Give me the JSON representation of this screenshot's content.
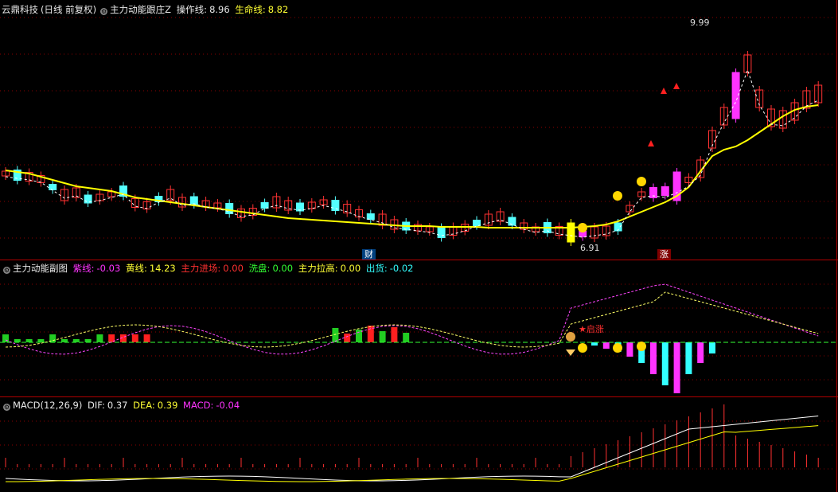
{
  "main_panel": {
    "stock": "云鼎科技",
    "period": "(日线 前复权)",
    "indicator": "主力动能跟庄Z",
    "op_line_label": "操作线:",
    "op_line_value": "8.96",
    "life_line_label": "生命线:",
    "life_line_value": "8.82",
    "high_label": "9.99",
    "low_label": "6.91",
    "marker_cai": "财",
    "marker_zhang": "涨"
  },
  "sub_panel": {
    "indicator": "主力动能副图",
    "purple_label": "紫线:",
    "purple_value": "-0.03",
    "yellow_label": "黄线:",
    "yellow_value": "14.23",
    "enter_label": "主力进场:",
    "enter_value": "0.00",
    "wash_label": "洗盘:",
    "wash_value": "0.00",
    "pull_label": "主力拉高:",
    "pull_value": "0.00",
    "ship_label": "出货:",
    "ship_value": "-0.02",
    "star_text": "★启涨"
  },
  "macd_panel": {
    "indicator": "MACD(12,26,9)",
    "dif_label": "DIF:",
    "dif_value": "0.37",
    "dea_label": "DEA:",
    "dea_value": "0.39",
    "macd_label": "MACD:",
    "macd_value": "-0.04"
  },
  "colors": {
    "up": "#ff3232",
    "down": "#54ffff",
    "life": "#ffff00",
    "op": "#ffffff",
    "purple": "#ff44ff",
    "yellow": "#ffff66",
    "grid": "#8b0000"
  },
  "icons": [
    "gear-icon",
    "smiley-icon",
    "moneybag-icon",
    "diamond-icon",
    "arrow-up-icon"
  ]
}
